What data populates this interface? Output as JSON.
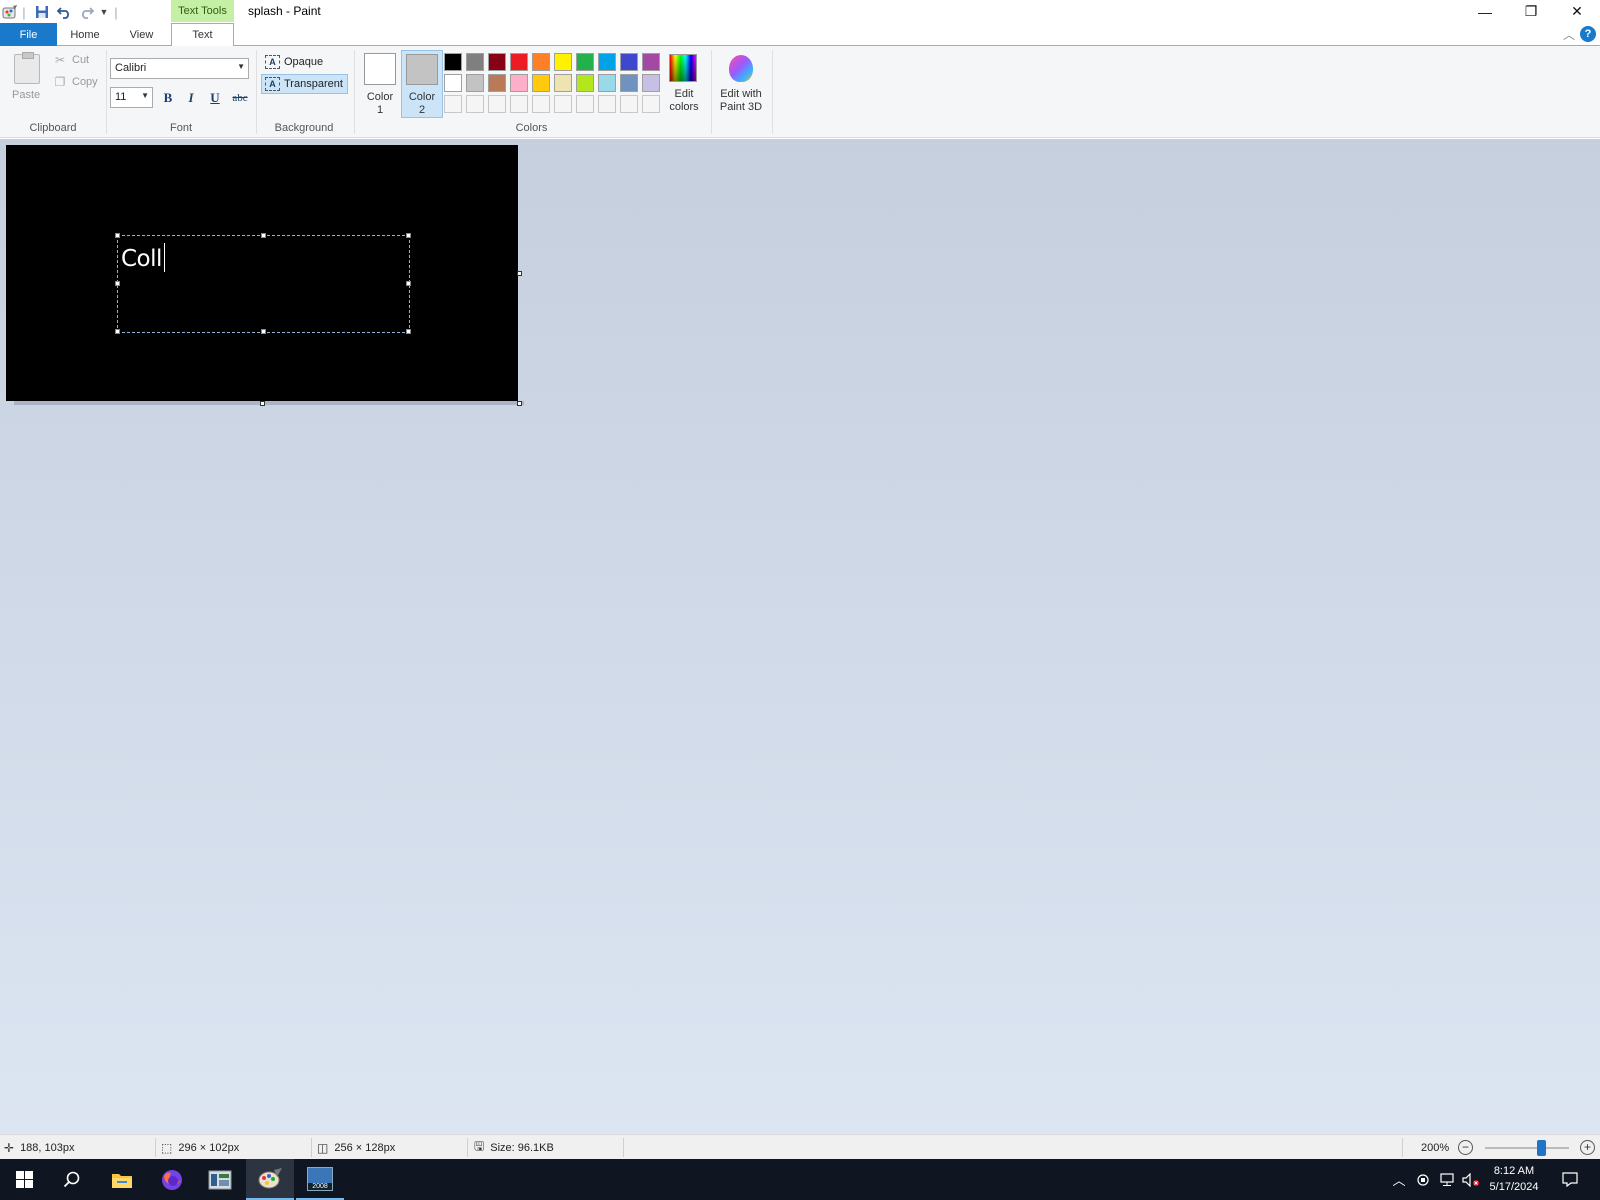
{
  "window": {
    "title": "splash - Paint",
    "contextual_tab": "Text Tools",
    "minimize_glyph": "—",
    "restore_glyph": "❐",
    "close_glyph": "✕"
  },
  "tabs": {
    "file": "File",
    "home": "Home",
    "view": "View",
    "text": "Text"
  },
  "help_glyph": "?",
  "collapse_glyph": "︿",
  "ribbon": {
    "clipboard": {
      "group": "Clipboard",
      "paste": "Paste",
      "cut": "Cut",
      "copy": "Copy"
    },
    "font": {
      "group": "Font",
      "family": "Calibri",
      "size": "11",
      "bold": "B",
      "italic": "I",
      "underline": "U",
      "strikethrough": "abc"
    },
    "background": {
      "group": "Background",
      "opaque": "Opaque",
      "transparent": "Transparent",
      "selected": "Transparent"
    },
    "colors": {
      "group": "Colors",
      "color1_line1": "Color",
      "color1_line2": "1",
      "color2_line1": "Color",
      "color2_line2": "2",
      "color1_value": "#ffffff",
      "color2_value": "#c3c3c3",
      "palette_row1": [
        "#000000",
        "#7f7f7f",
        "#880015",
        "#ed1c24",
        "#ff7f27",
        "#fff200",
        "#22b14c",
        "#00a2e8",
        "#3f48cc",
        "#a349a4"
      ],
      "palette_row2": [
        "#ffffff",
        "#c3c3c3",
        "#b97a57",
        "#ffaec9",
        "#ffc90e",
        "#efe4b0",
        "#b5e61d",
        "#99d9ea",
        "#7092be",
        "#c8bfe7"
      ],
      "palette_row3": [
        "#f5f5f5",
        "#f5f5f5",
        "#f5f5f5",
        "#f5f5f5",
        "#f5f5f5",
        "#f5f5f5",
        "#f5f5f5",
        "#f5f5f5",
        "#f5f5f5",
        "#f5f5f5"
      ],
      "edit_line1": "Edit",
      "edit_line2": "colors"
    },
    "paint3d": {
      "line1": "Edit with",
      "line2": "Paint 3D"
    }
  },
  "canvas": {
    "typed_text": "Coll",
    "background": "#000000"
  },
  "status": {
    "cursor_pos": "188, 103px",
    "selection_size": "296 × 102px",
    "image_size": "256 × 128px",
    "file_size": "Size: 96.1KB",
    "zoom": "200%",
    "zoom_level_percent": 200
  },
  "taskbar": {
    "time": "8:12 AM",
    "date": "5/17/2024",
    "server_label": "2008"
  }
}
